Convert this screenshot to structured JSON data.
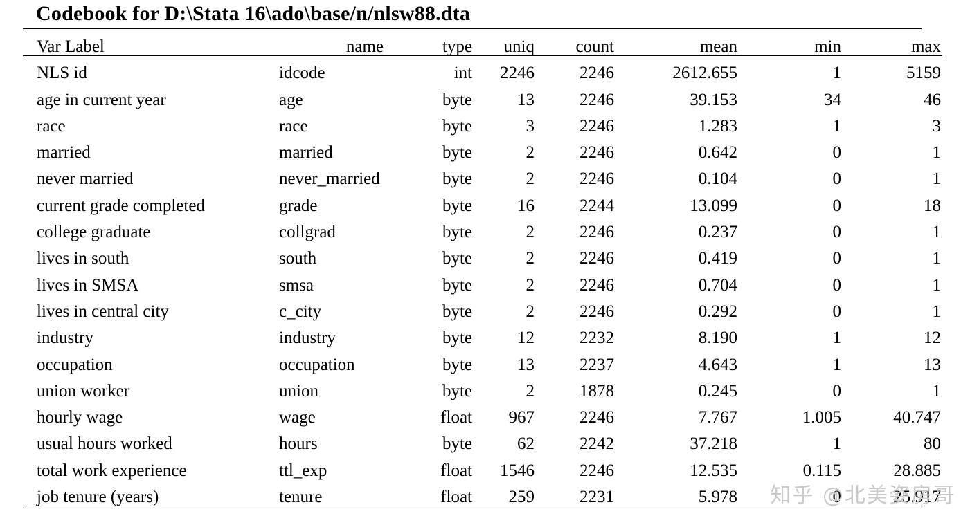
{
  "document": {
    "title": "Codebook for D:\\Stata 16\\ado\\base/n/nlsw88.dta"
  },
  "table": {
    "headers": {
      "label": "Var Label",
      "name": "name",
      "type": "type",
      "uniq": "uniq",
      "count": "count",
      "mean": "mean",
      "min": "min",
      "max": "max"
    },
    "rows": [
      {
        "label": "NLS id",
        "name": "idcode",
        "type": "int",
        "uniq": "2246",
        "count": "2246",
        "mean": "2612.655",
        "min": "1",
        "max": "5159"
      },
      {
        "label": "age in current year",
        "name": "age",
        "type": "byte",
        "uniq": "13",
        "count": "2246",
        "mean": "39.153",
        "min": "34",
        "max": "46"
      },
      {
        "label": "race",
        "name": "race",
        "type": "byte",
        "uniq": "3",
        "count": "2246",
        "mean": "1.283",
        "min": "1",
        "max": "3"
      },
      {
        "label": "married",
        "name": "married",
        "type": "byte",
        "uniq": "2",
        "count": "2246",
        "mean": "0.642",
        "min": "0",
        "max": "1"
      },
      {
        "label": "never married",
        "name": "never_married",
        "type": "byte",
        "uniq": "2",
        "count": "2246",
        "mean": "0.104",
        "min": "0",
        "max": "1"
      },
      {
        "label": "current grade completed",
        "name": "grade",
        "type": "byte",
        "uniq": "16",
        "count": "2244",
        "mean": "13.099",
        "min": "0",
        "max": "18"
      },
      {
        "label": "college graduate",
        "name": "collgrad",
        "type": "byte",
        "uniq": "2",
        "count": "2246",
        "mean": "0.237",
        "min": "0",
        "max": "1"
      },
      {
        "label": "lives in south",
        "name": "south",
        "type": "byte",
        "uniq": "2",
        "count": "2246",
        "mean": "0.419",
        "min": "0",
        "max": "1"
      },
      {
        "label": "lives in SMSA",
        "name": "smsa",
        "type": "byte",
        "uniq": "2",
        "count": "2246",
        "mean": "0.704",
        "min": "0",
        "max": "1"
      },
      {
        "label": "lives in central city",
        "name": "c_city",
        "type": "byte",
        "uniq": "2",
        "count": "2246",
        "mean": "0.292",
        "min": "0",
        "max": "1"
      },
      {
        "label": "industry",
        "name": "industry",
        "type": "byte",
        "uniq": "12",
        "count": "2232",
        "mean": "8.190",
        "min": "1",
        "max": "12"
      },
      {
        "label": "occupation",
        "name": "occupation",
        "type": "byte",
        "uniq": "13",
        "count": "2237",
        "mean": "4.643",
        "min": "1",
        "max": "13"
      },
      {
        "label": "union worker",
        "name": "union",
        "type": "byte",
        "uniq": "2",
        "count": "1878",
        "mean": "0.245",
        "min": "0",
        "max": "1"
      },
      {
        "label": "hourly wage",
        "name": "wage",
        "type": "float",
        "uniq": "967",
        "count": "2246",
        "mean": "7.767",
        "min": "1.005",
        "max": "40.747"
      },
      {
        "label": "usual hours worked",
        "name": "hours",
        "type": "byte",
        "uniq": "62",
        "count": "2242",
        "mean": "37.218",
        "min": "1",
        "max": "80"
      },
      {
        "label": "total work experience",
        "name": "ttl_exp",
        "type": "float",
        "uniq": "1546",
        "count": "2246",
        "mean": "12.535",
        "min": "0.115",
        "max": "28.885"
      },
      {
        "label": "job tenure (years)",
        "name": "tenure",
        "type": "float",
        "uniq": "259",
        "count": "2231",
        "mean": "5.978",
        "min": "0",
        "max": "25.917"
      }
    ]
  },
  "watermark": {
    "text": "知乎 @北美姿房哥",
    "color": "#c9c9c9"
  },
  "colors": {
    "background": "#ffffff",
    "text": "#000000",
    "rule": "#000000"
  }
}
